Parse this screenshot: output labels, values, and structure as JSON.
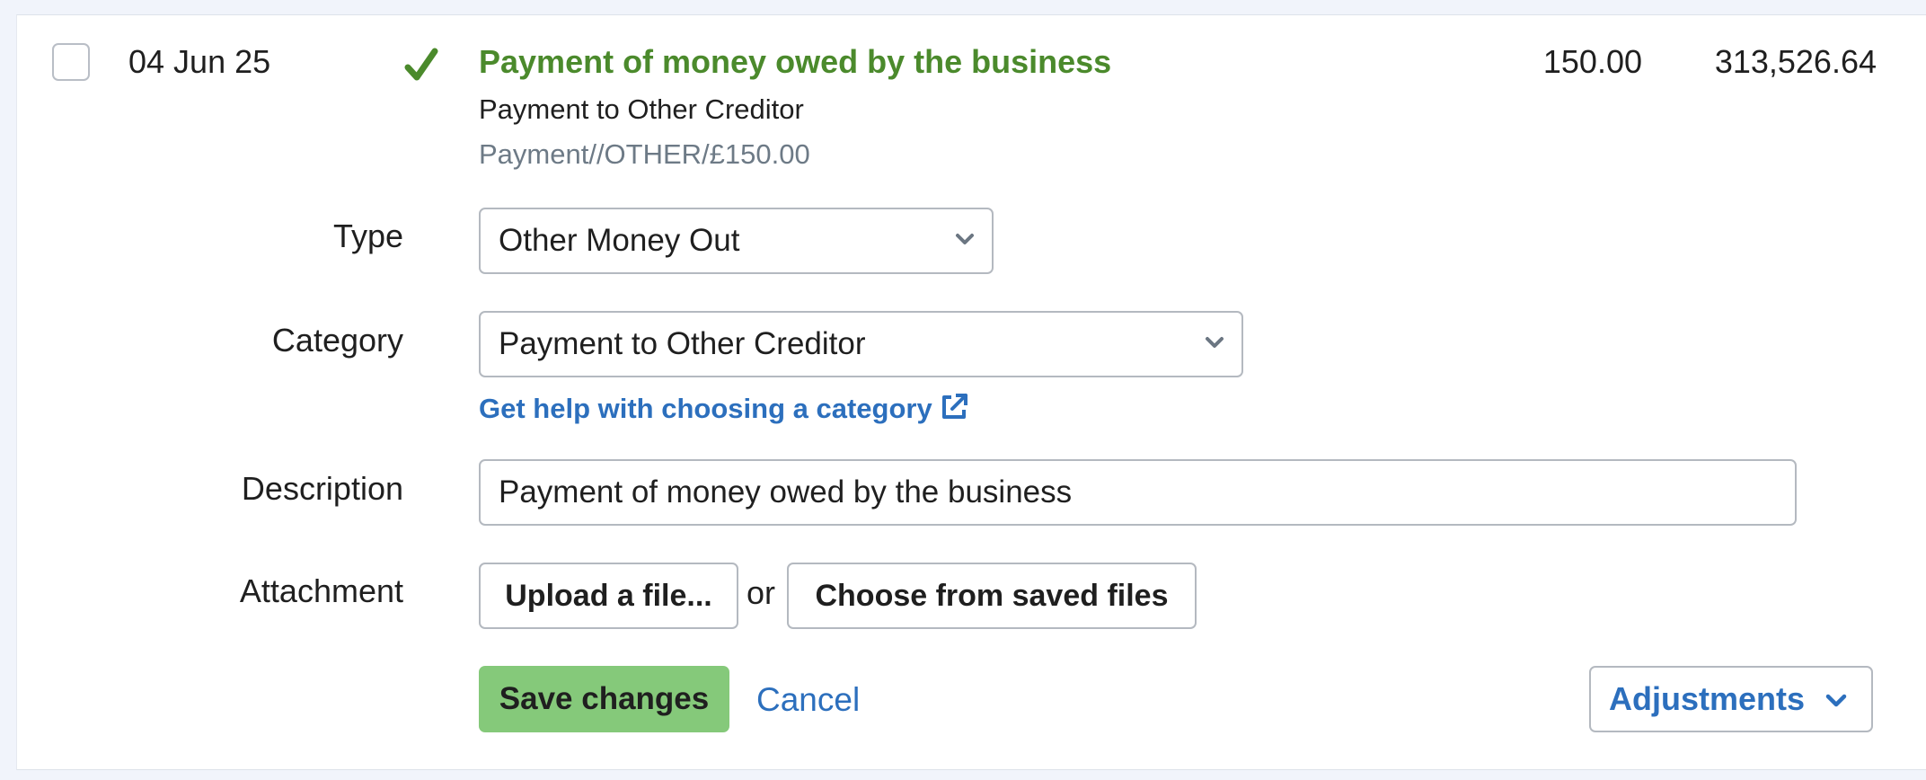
{
  "transaction": {
    "date": "04 Jun 25",
    "status_icon": "check-icon",
    "title": "Payment of money owed by the business",
    "subtitle": "Payment to Other Creditor",
    "reference": "Payment//OTHER/£150.00",
    "amount": "150.00",
    "balance": "313,526.64"
  },
  "form": {
    "type_label": "Type",
    "type_value": "Other Money Out",
    "category_label": "Category",
    "category_value": "Payment to Other Creditor",
    "help_link": "Get help with choosing a category",
    "description_label": "Description",
    "description_value": "Payment of money owed by the business",
    "attachment_label": "Attachment",
    "upload_button": "Upload a file...",
    "or_text": "or",
    "saved_files_button": "Choose from saved files"
  },
  "actions": {
    "save": "Save changes",
    "cancel": "Cancel",
    "adjustments": "Adjustments"
  },
  "colors": {
    "title_green": "#4b8a2c",
    "link_blue": "#2c6fbd",
    "save_green": "#85c97a",
    "background": "#f1f4fb"
  }
}
